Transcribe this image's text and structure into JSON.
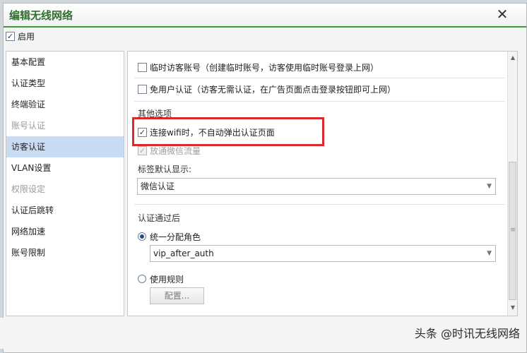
{
  "dialog": {
    "title": "编辑无线网络"
  },
  "enable": {
    "label": "启用",
    "checked": true
  },
  "sidebar": {
    "items": [
      {
        "label": "基本配置",
        "state": "normal"
      },
      {
        "label": "认证类型",
        "state": "normal"
      },
      {
        "label": "终端验证",
        "state": "normal"
      },
      {
        "label": "账号认证",
        "state": "disabled"
      },
      {
        "label": "访客认证",
        "state": "active"
      },
      {
        "label": "VLAN设置",
        "state": "normal"
      },
      {
        "label": "权限设定",
        "state": "disabled"
      },
      {
        "label": "认证后跳转",
        "state": "normal"
      },
      {
        "label": "网络加速",
        "state": "normal"
      },
      {
        "label": "账号限制",
        "state": "normal"
      }
    ]
  },
  "content": {
    "temp_account": {
      "label": "临时访客账号（创建临时账号，访客使用临时账号登录上网）",
      "checked": false
    },
    "no_auth": {
      "label": "免用户认证（访客无需认证，在广告页面点击登录按钮即可上网）",
      "checked": false
    },
    "other_options_title": "其他选项",
    "no_popup": {
      "label": "连接wifi时，不自动弹出认证页面",
      "checked": true
    },
    "wechat_flow": {
      "label": "放通微信流量",
      "checked": true
    },
    "tag_default_label": "标签默认显示:",
    "tag_default_select": {
      "value": "微信认证"
    },
    "after_auth_title": "认证通过后",
    "assign_role": {
      "label": "统一分配角色",
      "selected": true
    },
    "role_select": {
      "value": "vip_after_auth"
    },
    "use_rules": {
      "label": "使用规则",
      "selected": false
    },
    "config_button": "配置..."
  },
  "watermark": "头条 @时讯无线网络",
  "icons": {
    "close": "close-icon",
    "scroll_up": "scroll-up-arrow-icon",
    "scroll_down": "scroll-down-arrow-icon",
    "dropdown": "chevron-down-icon"
  },
  "colors": {
    "accent_green": "#3a9a3a",
    "highlight_red": "#d9292b",
    "active_item_bg": "#c9dcf3"
  }
}
